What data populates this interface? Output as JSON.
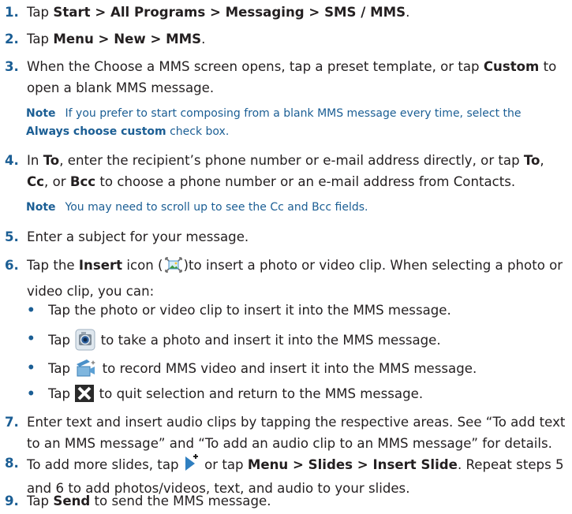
{
  "steps": [
    {
      "num": "1.",
      "p1": "Tap ",
      "b1": "Start > All Programs > Messaging > SMS / MMS",
      "p2": "."
    },
    {
      "num": "2.",
      "p1": "Tap ",
      "b1": "Menu > New > MMS",
      "p2": "."
    },
    {
      "num": "3.",
      "p1": "When the Choose a MMS screen opens, tap a preset template, or tap ",
      "b1": "Custom",
      "p2": " to open a blank MMS message."
    },
    {
      "num": "4.",
      "p1": "In ",
      "b1": "To",
      "p2": ", enter the recipient’s phone number or e-mail address directly, or tap ",
      "b2": "To",
      "p3": ", ",
      "b3": "Cc",
      "p4": ", or ",
      "b4": "Bcc",
      "p5": " to choose a phone number or an e-mail address from Contacts."
    },
    {
      "num": "5.",
      "p1": "Enter a subject for your message."
    },
    {
      "num": "6.",
      "p1": "Tap the ",
      "b1": "Insert",
      "p2": " icon (",
      "p3": ")to insert a photo or video clip. When selecting a photo or video clip, you can:"
    },
    {
      "num": "7.",
      "p1": "Enter text and insert audio clips by tapping the respective areas. See “To add text to an MMS message” and “To add an audio clip to an MMS message” for details."
    },
    {
      "num": "8.",
      "p1": "To add more slides, tap ",
      "p2": " or tap ",
      "b1": "Menu > Slides > Insert Slide",
      "p3": ". Repeat steps 5 and 6 to add photos/videos, text, and audio to your slides."
    },
    {
      "num": "9.",
      "p1": "Tap ",
      "b1": "Send",
      "p2": " to send the MMS message."
    }
  ],
  "notes": [
    {
      "label": "Note",
      "p1": "If you prefer to start composing from a blank MMS message every time, select the ",
      "b1": "Always choose custom",
      "p2": " check box."
    },
    {
      "label": "Note",
      "p1": "You may need to scroll up to see the Cc and Bcc fields."
    }
  ],
  "bullets": [
    {
      "dot": "•",
      "p1": "Tap the photo or video clip to insert it into the MMS message."
    },
    {
      "dot": "•",
      "p1": "Tap ",
      "p2": " to take a photo and insert it into the MMS message."
    },
    {
      "dot": "•",
      "p1": "Tap ",
      "p2": " to record MMS video and insert it into the MMS message."
    },
    {
      "dot": "•",
      "p1": "Tap ",
      "p2": " to quit selection and return to the MMS message."
    }
  ],
  "icons": {
    "insert": "insert-picture-icon",
    "camera": "camera-icon",
    "video": "video-camera-icon",
    "close": "close-x-icon",
    "slide": "insert-slide-icon"
  },
  "colors": {
    "accent": "#1b5e94",
    "text": "#231f20"
  }
}
